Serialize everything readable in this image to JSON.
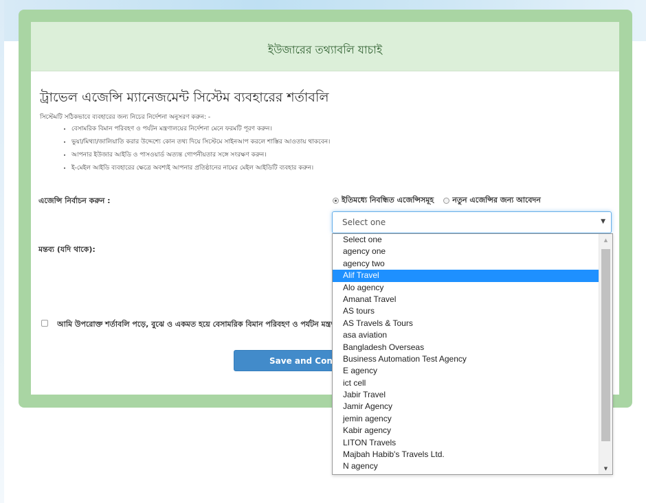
{
  "panel": {
    "title": "ইউজারের তথ্যাবলি যাচাই"
  },
  "terms": {
    "title": "ট্রাভেল এজেন্সি ম্যানেজমেন্ট সিস্টেম ব্যবহারের শর্তাবলি",
    "intro": "সিস্টেমটি সঠিকভাবে ব্যবহারের জন্য নিচের নির্দেশনা অনুসরণ করুন: -",
    "rules": [
      "বেসামরিক বিমান পরিবহণ ও পর্যটন মন্ত্রণালয়ের নির্দেশনা মেনে ফরমটি পূরণ করুন।",
      "ভুয়া/মিথ্যা/জালিয়াতি করার উদ্দেশ্যে কোন তথ্য দিয়ে সিস্টেমে সাইনআপ করলে শাস্তির আওতায় থাকবেন।",
      "আপনার ইউজার আইডি ও পাসওয়ার্ড অত্যন্ত গোপনীয়তার সঙ্গে সংরক্ষণ করুন।",
      "ই-মেইল আইডি ব্যবহারের ক্ষেত্রে অবশ্যই আপনার প্রতিষ্ঠানের নামের মেইল আইডিটি ব্যবহার করুন।"
    ]
  },
  "form": {
    "agency_label": "এজেন্সি নির্বাচন করুন :",
    "radio_existing": "ইতিমধ্যে নিবন্ধিত এজেন্সিসমূহ",
    "radio_new": "নতুন এজেন্সির জন্য আবেদন",
    "select_value": "Select one",
    "comment_label": "মন্তব্য (যদি থাকে):",
    "agree_text": "আমি উপরোক্ত শর্তাবলি পড়ে, বুঝে ও একমত হয়ে বেসামরিক বিমান পরিবহণ ও পর্যটন মন্ত্রণালয়ের",
    "save_label": "Save and Continue"
  },
  "dropdown": {
    "options": [
      "Select one",
      "agency one",
      "agency two",
      "Alif Travel",
      "Alo agency",
      "Amanat Travel",
      "AS tours",
      "AS Travels & Tours",
      "asa aviation",
      "Bangladesh Overseas",
      "Business Automation Test Agency",
      "E agency",
      "ict cell",
      "Jabir Travel",
      "Jamir Agency",
      "jemin agency",
      "Kabir agency",
      "LITON Travels",
      "Majbah Habib's Travels Ltd.",
      "N agency"
    ],
    "highlighted": "Alif Travel"
  },
  "colors": {
    "frame": "#a9d5a3",
    "header": "#dcefd9",
    "button": "#428bca",
    "highlight": "#1e90ff"
  }
}
